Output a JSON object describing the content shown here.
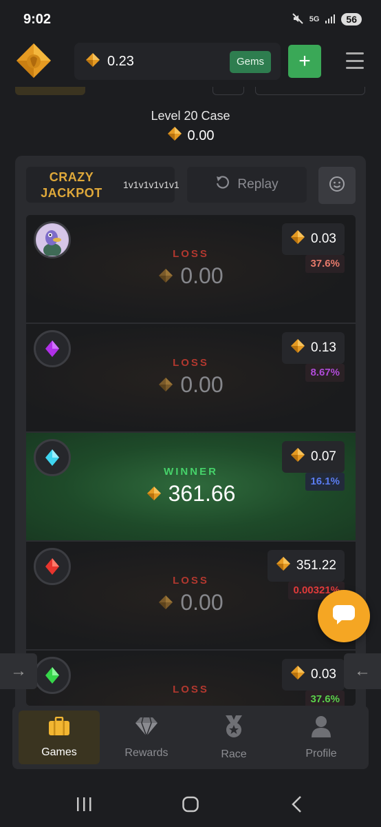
{
  "status_bar": {
    "time": "9:02",
    "network": "5G",
    "battery": "56"
  },
  "header": {
    "balance": "0.23",
    "gems_label": "Gems",
    "add_label": "+"
  },
  "case": {
    "title": "Level 20 Case",
    "price": "0.00"
  },
  "battle": {
    "mode_title": "CRAZY JACKPOT",
    "mode_line1": "CRAZY",
    "mode_line2": "JACKPOT",
    "format": "1v1v1v1v1v1",
    "replay_label": "Replay"
  },
  "players": [
    {
      "result": "LOSS",
      "amount": "0.00",
      "bet": "0.03",
      "chance": "37.6%",
      "chance_color": "#e77a6b",
      "avatar": "duck-avatar"
    },
    {
      "result": "LOSS",
      "amount": "0.00",
      "bet": "0.13",
      "chance": "8.67%",
      "chance_color": "#b04bd8",
      "avatar": "purple-gem-icon",
      "gem_color": "#b030e8"
    },
    {
      "result": "WINNER",
      "amount": "361.66",
      "bet": "0.07",
      "chance": "16.1%",
      "chance_color": "#5a7cf0",
      "avatar": "cyan-gem-icon",
      "gem_color": "#3fd6f0"
    },
    {
      "result": "LOSS",
      "amount": "0.00",
      "bet": "351.22",
      "chance": "0.00321%",
      "chance_color": "#e03a3a",
      "avatar": "red-gem-icon",
      "gem_color": "#e8352e"
    },
    {
      "result": "LOSS",
      "amount": "",
      "bet": "0.03",
      "chance": "37.6%",
      "chance_color": "#5ad04a",
      "avatar": "green-gem-icon",
      "gem_color": "#36d64a"
    }
  ],
  "nav": {
    "games": "Games",
    "rewards": "Rewards",
    "race": "Race",
    "profile": "Profile"
  },
  "colors": {
    "accent_gold": "#e0a93a",
    "win_green": "#46d26a",
    "loss_red": "#b2382f",
    "chat_orange": "#f5a623"
  }
}
